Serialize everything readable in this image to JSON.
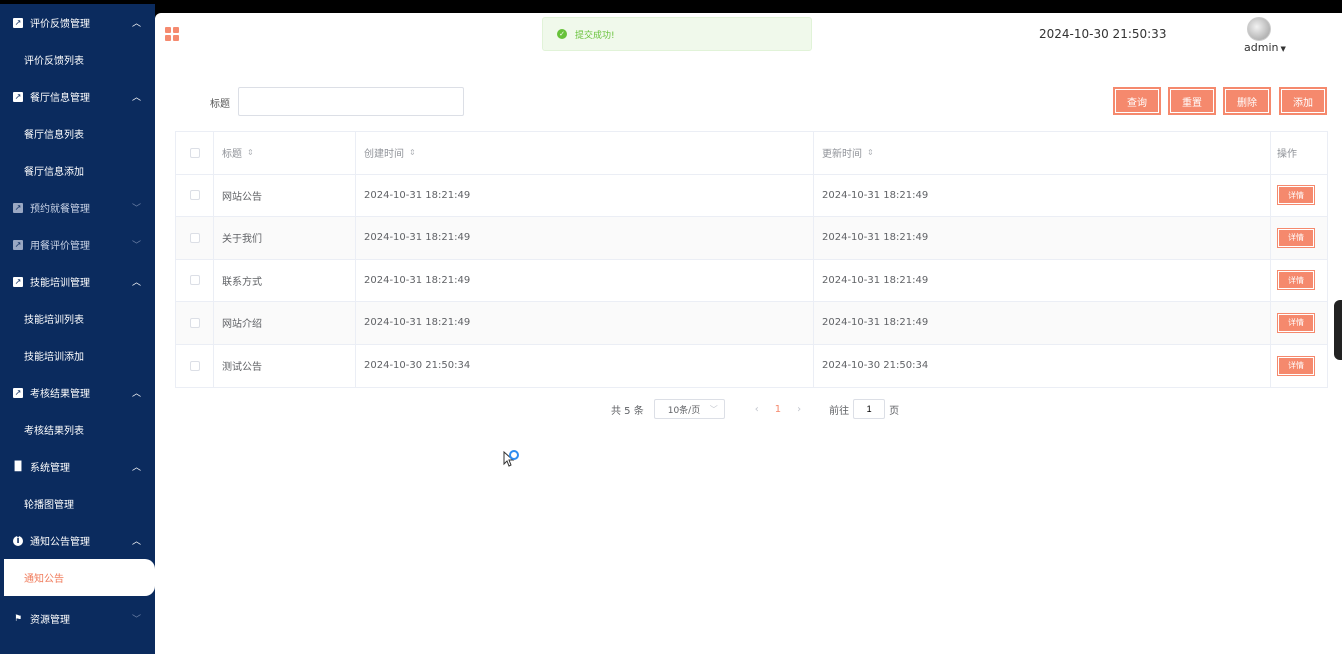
{
  "sidebar": {
    "groups": [
      {
        "label": "评价反馈管理",
        "icon": "chart-icon",
        "items": [
          "评价反馈列表"
        ]
      },
      {
        "label": "餐厅信息管理",
        "icon": "chart-icon",
        "items": [
          "餐厅信息列表",
          "餐厅信息添加"
        ]
      },
      {
        "label": "预约就餐管理",
        "icon": "chart-icon",
        "items": []
      },
      {
        "label": "用餐评价管理",
        "icon": "chart-icon",
        "items": []
      },
      {
        "label": "技能培训管理",
        "icon": "chart-icon",
        "items": [
          "技能培训列表",
          "技能培训添加"
        ]
      },
      {
        "label": "考核结果管理",
        "icon": "chart-icon",
        "items": [
          "考核结果列表"
        ]
      },
      {
        "label": "系统管理",
        "icon": "bar-chart-icon",
        "items": [
          "轮播图管理"
        ]
      },
      {
        "label": "通知公告管理",
        "icon": "info-icon",
        "items": [
          "通知公告"
        ]
      },
      {
        "label": "资源管理",
        "icon": "flag-icon",
        "items": []
      }
    ],
    "active_item": "通知公告"
  },
  "header": {
    "toast": "提交成功!",
    "datetime": "2024-10-30 21:50:33",
    "user": "admin"
  },
  "search": {
    "label": "标题",
    "value": "",
    "buttons": {
      "query": "查询",
      "reset": "重置",
      "delete": "删除",
      "add": "添加"
    }
  },
  "table": {
    "headers": {
      "title": "标题",
      "created": "创建时间",
      "updated": "更新时间",
      "op": "操作"
    },
    "rows": [
      {
        "title": "网站公告",
        "created": "2024-10-31 18:21:49",
        "updated": "2024-10-31 18:21:49",
        "op": "详情"
      },
      {
        "title": "关于我们",
        "created": "2024-10-31 18:21:49",
        "updated": "2024-10-31 18:21:49",
        "op": "详情"
      },
      {
        "title": "联系方式",
        "created": "2024-10-31 18:21:49",
        "updated": "2024-10-31 18:21:49",
        "op": "详情"
      },
      {
        "title": "网站介绍",
        "created": "2024-10-31 18:21:49",
        "updated": "2024-10-31 18:21:49",
        "op": "详情"
      },
      {
        "title": "测试公告",
        "created": "2024-10-30 21:50:34",
        "updated": "2024-10-30 21:50:34",
        "op": "详情"
      }
    ]
  },
  "pagination": {
    "total": "共 5 条",
    "page_size": "10条/页",
    "prev": "‹",
    "current": "1",
    "next": "›",
    "goto_label": "前往",
    "goto_value": "1",
    "page_suffix": "页"
  },
  "colors": {
    "sidebar_bg": "#0b2b5e",
    "accent": "#f5896d",
    "toast_green": "#67c23a"
  }
}
